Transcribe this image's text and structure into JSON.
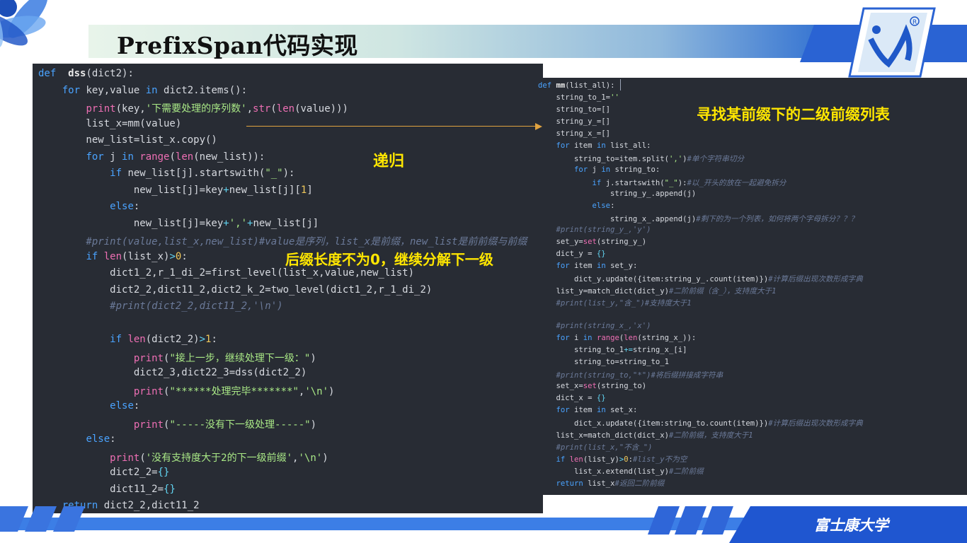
{
  "slide": {
    "title": "PrefixSpan代码实现",
    "university": "富士康大学"
  },
  "annotations": {
    "recursion": "递归",
    "suffix_condition": "后缀长度不为0，继续分解下一级",
    "find_prefix": "寻找某前缀下的二级前缀列表"
  },
  "code_left": [
    "def  dss(dict2):",
    "    for key,value in dict2.items():",
    "        print(key,'下需要处理的序列数',str(len(value)))",
    "        list_x=mm(value)",
    "        new_list=list_x.copy()",
    "        for j in range(len(new_list)):",
    "            if new_list[j].startswith(\"_\"):",
    "                new_list[j]=key+new_list[j][1]",
    "            else:",
    "                new_list[j]=key+','+new_list[j]",
    "        #print(value,list_x,new_list)#value是序列，list_x是前缀，new_list是前前缀与前缀",
    "        if len(list_x)>0:",
    "            dict1_2,r_1_di_2=first_level(list_x,value,new_list)",
    "            dict2_2,dict11_2,dict2_k_2=two_level(dict1_2,r_1_di_2)",
    "            #print(dict2_2,dict11_2,'\\n')",
    "",
    "            if len(dict2_2)>1:",
    "                print(\"接上一步，继续处理下一级：\")",
    "                dict2_3,dict22_3=dss(dict2_2)",
    "                print(\"******处理完毕*******\",'\\n')",
    "            else:",
    "                print(\"-----没有下一级处理-----\")",
    "        else:",
    "            print('没有支持度大于2的下一级前缀','\\n')",
    "            dict2_2={}",
    "            dict11_2={}",
    "    return dict2_2,dict11_2"
  ],
  "code_right": [
    "def mm(list_all):",
    "    string_to_1=''",
    "    string_to=[]",
    "    string_y_=[]",
    "    string_x_=[]",
    "    for item in list_all:",
    "        string_to=item.split(',')#单个字符串切分",
    "        for j in string_to:",
    "            if j.startswith(\"_\"):#以_开头的放在一起避免拆分",
    "                string_y_.append(j)",
    "            else:",
    "                string_x_.append(j)#剩下的为一个列表，如何将两个字母拆分？？？",
    "    #print(string_y_,'y')",
    "    set_y=set(string_y_)",
    "    dict_y = {}",
    "    for item in set_y:",
    "        dict_y.update({item:string_y_.count(item)})#计算后缀出现次数形成字典",
    "    list_y=match_dict(dict_y)#二阶前缀（含_），支持度大于1",
    "    #print(list_y,\"含_\")#支持度大于1",
    "",
    "    #print(string_x_,'x')",
    "    for i in range(len(string_x_)):",
    "        string_to_1+=string_x_[i]",
    "        string_to=string_to_1",
    "    #print(string_to,\"*\")#将后缀拼接成字符串",
    "    set_x=set(string_to)",
    "    dict_x = {}",
    "    for item in set_x:",
    "        dict_x.update({item:string_to.count(item)})#计算后缀出现次数形成字典",
    "    list_x=match_dict(dict_x)#二阶前缀，支持度大于1",
    "    #print(list_x,\"不含_\")",
    "    if len(list_y)>0:#list_y不为空",
    "        list_x.extend(list_y)#二阶前缀",
    "    return list_x#返回二阶前缀"
  ]
}
